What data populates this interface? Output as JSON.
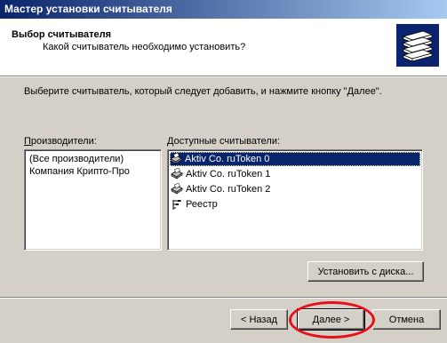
{
  "window": {
    "title": "Мастер установки считывателя"
  },
  "header": {
    "title": "Выбор считывателя",
    "subtitle": "Какой считыватель необходимо установить?",
    "logo_icon": "server-stack-icon"
  },
  "instructions": "Выберите считыватель, который следует добавить, и нажмите кнопку \"Далее\".",
  "manufacturers": {
    "label_mnemonic": "П",
    "label_rest": "роизводители:",
    "items": [
      "(Все производители)",
      "Компания Крипто-Про"
    ]
  },
  "readers": {
    "label_mnemonic": "Д",
    "label_rest": "оступные считыватели:",
    "items": [
      {
        "name": "Aktiv Co. ruToken 0",
        "icon": "smartcard-reader-icon",
        "selected": true
      },
      {
        "name": "Aktiv Co. ruToken 1",
        "icon": "smartcard-reader-icon",
        "selected": false
      },
      {
        "name": "Aktiv Co. ruToken 2",
        "icon": "smartcard-reader-icon",
        "selected": false
      },
      {
        "name": "Реестр",
        "icon": "registry-icon",
        "selected": false
      }
    ]
  },
  "buttons": {
    "install_from_disk": "Установить с диска...",
    "back": "< Назад",
    "next": "Далее >",
    "cancel": "Отмена"
  },
  "colors": {
    "selection": "#0a246a",
    "highlight_circle": "#e8101a",
    "face": "#d4d0c8"
  }
}
